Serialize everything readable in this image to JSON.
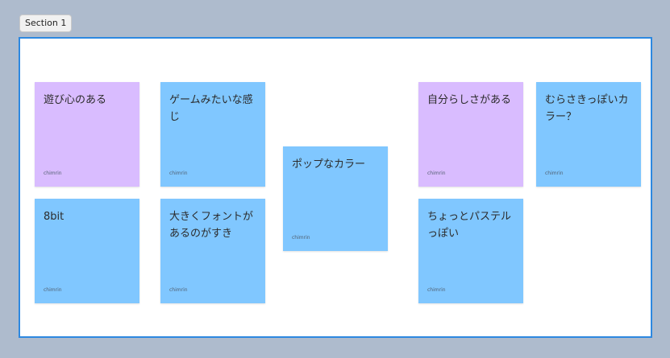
{
  "section": {
    "label": "Section 1",
    "border_color": "#2d88e0"
  },
  "colors": {
    "blue": "#80c7ff",
    "purple": "#d9bcff",
    "canvas": "#aebbcd"
  },
  "stickies": [
    {
      "text": "遊び心のある",
      "author": "chimrin",
      "color": "purple"
    },
    {
      "text": "ゲームみたいな感じ",
      "author": "chimrin",
      "color": "blue"
    },
    {
      "text": "8bit",
      "author": "chimrin",
      "color": "blue"
    },
    {
      "text": "大きくフォントがあるのがすき",
      "author": "chimrin",
      "color": "blue"
    },
    {
      "text": "ポップなカラー",
      "author": "chimrin",
      "color": "blue"
    },
    {
      "text": "自分らしさがある",
      "author": "chimrin",
      "color": "purple"
    },
    {
      "text": "むらさきっぽいカラー？",
      "author": "chimrin",
      "color": "blue"
    },
    {
      "text": "ちょっとパステルっぽい",
      "author": "chimrin",
      "color": "blue"
    }
  ]
}
